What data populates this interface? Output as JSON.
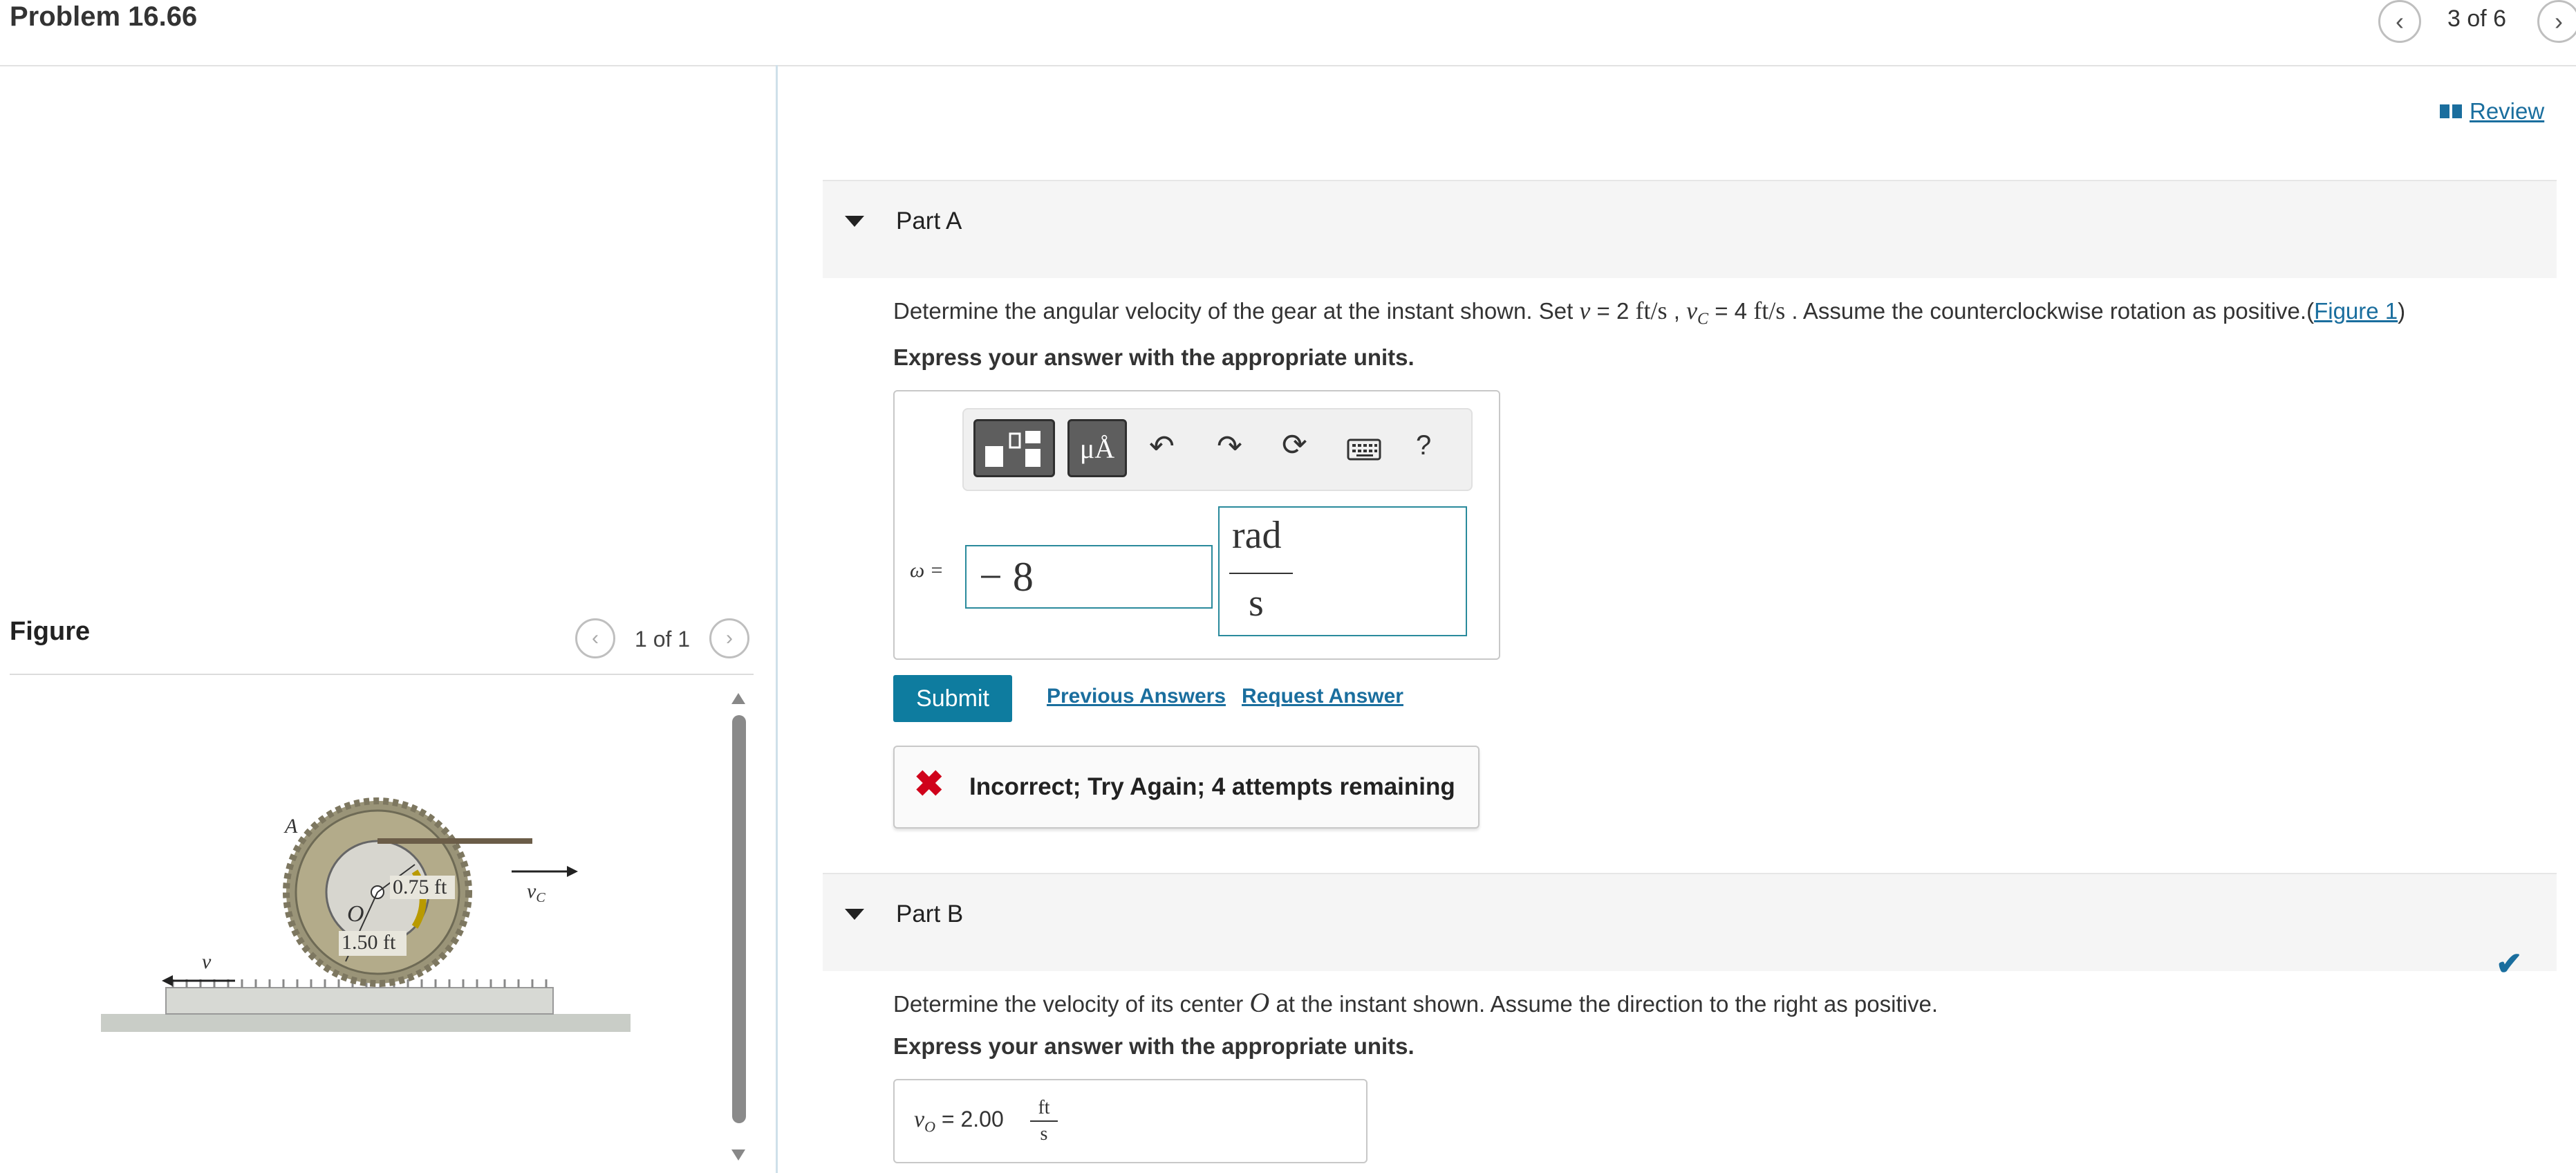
{
  "header": {
    "problem_title": "Problem 16.66",
    "pager": "3 of 6"
  },
  "figure_panel": {
    "title": "Figure",
    "pager": "1 of 1",
    "labels": {
      "point_a": "A",
      "center": "O",
      "inner_radius": "0.75 ft",
      "outer_radius": "1.50 ft",
      "v": "v",
      "vc": "v",
      "vc_sub": "C"
    }
  },
  "review": {
    "label": "Review"
  },
  "part_a": {
    "title": "Part A",
    "q_pre": "Determine the angular velocity of the gear at the instant shown. Set ",
    "q_v": "v",
    "q_eq1": " = 2 ",
    "q_unit": "ft/s",
    "q_comma": " , ",
    "q_vc": "v",
    "q_vc_sub": "C",
    "q_eq2": " = 4 ",
    "q_post": " . Assume the counterclockwise rotation as positive.(",
    "figure_link": "Figure 1",
    "q_close": ")",
    "instruction": "Express your answer with the appropriate units.",
    "toolbar": {
      "units_symbol": "μÅ",
      "help": "?"
    },
    "answer_label": "ω =",
    "answer_value": "− 8",
    "unit_numerator": "rad",
    "unit_denominator": "s",
    "submit_label": "Submit",
    "previous_answers_label": "Previous Answers",
    "request_answer_label": "Request Answer",
    "feedback": "Incorrect; Try Again; 4 attempts remaining"
  },
  "part_b": {
    "title": "Part B",
    "q_pre": "Determine the velocity of its center ",
    "q_o": "O",
    "q_post": " at the instant shown. Assume the direction to the right as positive.",
    "instruction": "Express your answer with the appropriate units.",
    "answer_var": "v",
    "answer_sub": "O",
    "answer_eq": " = ",
    "answer_value": "2.00",
    "unit_num": "ft",
    "unit_den": "s"
  },
  "colors": {
    "accent": "#0e7c9f",
    "link": "#1a6e9e",
    "error": "#d0021b",
    "input_border": "#2a8a9c"
  }
}
